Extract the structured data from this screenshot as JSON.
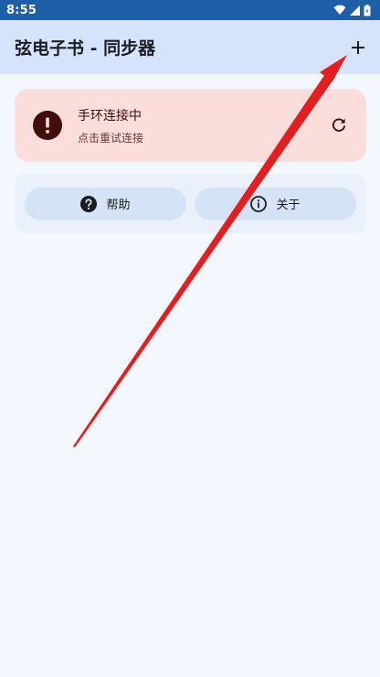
{
  "status_bar": {
    "time": "8:55"
  },
  "app_bar": {
    "title": "弦电子书 - 同步器",
    "add_label": "+"
  },
  "connection_card": {
    "title": "手环连接中",
    "subtitle": "点击重试连接"
  },
  "actions": {
    "help_label": "帮助",
    "about_label": "关于"
  },
  "colors": {
    "app_bar": "#d5e3fc",
    "error_container": "#fbdedb",
    "error_icon": "#410e0b",
    "annotation_arrow": "#e41e1e"
  },
  "icons": {
    "status": [
      "wifi-icon",
      "signal-icon",
      "battery-icon"
    ],
    "app_bar": "add-icon",
    "card": [
      "error-icon",
      "refresh-icon"
    ],
    "actions": [
      "help-icon",
      "info-icon"
    ]
  }
}
